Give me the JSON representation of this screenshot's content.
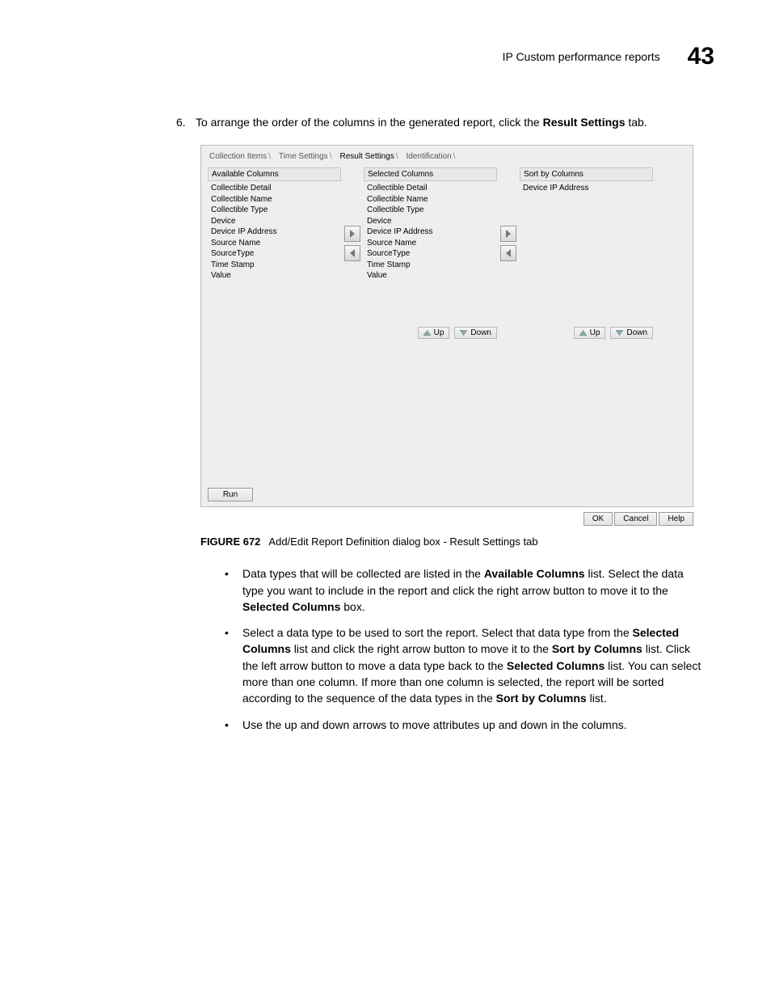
{
  "header": {
    "title": "IP Custom performance reports",
    "chapter": "43"
  },
  "step6": {
    "num": "6.",
    "prefix": "To arrange the order of the columns in the generated report, click the ",
    "bold": "Result Settings",
    "suffix": " tab."
  },
  "dialog": {
    "tabs": {
      "t1": "Collection Items",
      "t2": "Time Settings",
      "t3": "Result Settings",
      "t4": "Identification"
    },
    "labels": {
      "available": "Available Columns",
      "selected": "Selected Columns",
      "sortby": "Sort by Columns"
    },
    "available": {
      "i0": "Collectible Detail",
      "i1": "Collectible Name",
      "i2": "Collectible Type",
      "i3": "Device",
      "i4": "Device IP Address",
      "i5": "Source Name",
      "i6": "SourceType",
      "i7": "Time Stamp",
      "i8": "Value"
    },
    "selected": {
      "i0": "Collectible Detail",
      "i1": "Collectible Name",
      "i2": "Collectible Type",
      "i3": "Device",
      "i4": "Device IP Address",
      "i5": "Source Name",
      "i6": "SourceType",
      "i7": "Time Stamp",
      "i8": "Value"
    },
    "sortby": {
      "i0": "Device IP Address"
    },
    "buttons": {
      "up": "Up",
      "down": "Down",
      "run": "Run",
      "ok": "OK",
      "cancel": "Cancel",
      "help": "Help"
    }
  },
  "caption": {
    "label": "FIGURE 672",
    "text": "Add/Edit Report Definition dialog box - Result Settings tab"
  },
  "bullets": {
    "b1a": "Data types that will be collected are listed in the ",
    "b1b": "Available Columns",
    "b1c": " list. Select the data type you want to include in the report and click the right arrow button to move it to the ",
    "b1d": "Selected Columns",
    "b1e": " box.",
    "b2a": "Select a data type to be used to sort the report. Select that data type from the ",
    "b2b": "Selected Columns",
    "b2c": " list and click the right arrow button to move it to the ",
    "b2d": "Sort by Columns",
    "b2e": " list. Click the left arrow button to move a data type back to the ",
    "b2f": "Selected Columns",
    "b2g": " list. You can select more than one column. If more than one column is selected, the report will be sorted according to the sequence of the data types in the ",
    "b2h": "Sort by Columns",
    "b2i": " list.",
    "b3": "Use the up and down arrows to move attributes up and down in the columns."
  }
}
